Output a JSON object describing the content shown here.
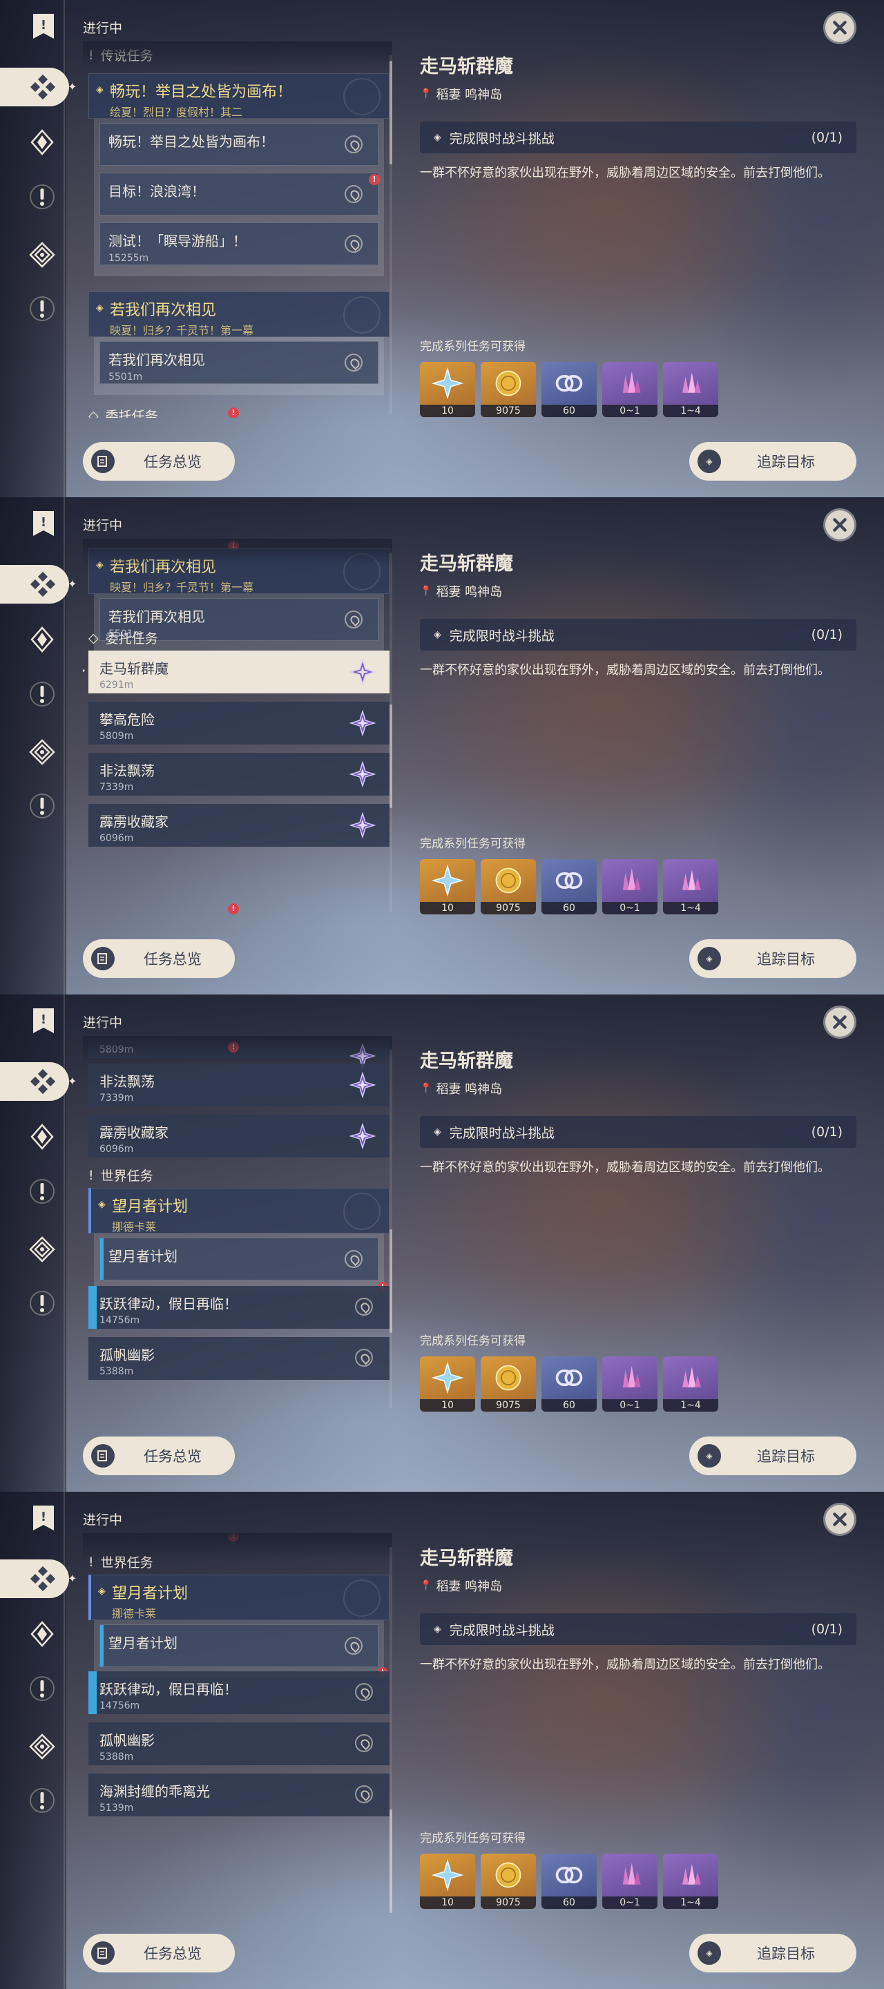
{
  "header": {
    "in_progress": "进行中"
  },
  "sections": {
    "legend": "传说任务",
    "commission": "委托任务",
    "world": "世界任务",
    "commission_cut": "委托任务",
    "world_cut": "世界任务"
  },
  "legend_quests": [
    {
      "title": "畅玩！举目之处皆为画布！",
      "subtitle": "绘夏！烈日？度假村！其二",
      "subs": [
        {
          "title": "畅玩！举目之处皆为画布！",
          "dist": ""
        },
        {
          "title": "目标！浪浪湾！",
          "dist": ""
        },
        {
          "title": "测试！「瞑导游船」！",
          "dist": "15255m"
        }
      ]
    },
    {
      "title": "若我们再次相见",
      "subtitle": "映夏！归乡？千灵节！第一幕",
      "subs": [
        {
          "title": "若我们再次相见",
          "dist": "5501m"
        }
      ]
    }
  ],
  "commissions": [
    {
      "title": "走马斩群魔",
      "dist": "6291m"
    },
    {
      "title": "攀高危险",
      "dist": "5809m"
    },
    {
      "title": "非法飘荡",
      "dist": "7339m"
    },
    {
      "title": "霹雳收藏家",
      "dist": "6096m"
    }
  ],
  "world_quests": {
    "parent_title": "望月者计划",
    "parent_sub": "挪德卡莱",
    "sub_title": "望月者计划",
    "items": [
      {
        "title": "跃跃律动，假日再临！",
        "dist": "14756m"
      },
      {
        "title": "孤帆幽影",
        "dist": "5388m"
      },
      {
        "title": "海渊封缠的乖离光",
        "dist": "5139m"
      }
    ]
  },
  "detail": {
    "title": "走马斩群魔",
    "location": "稻妻 鸣神岛",
    "objective": "完成限时战斗挑战",
    "objective_count": "(0/1)",
    "description": "一群不怀好意的家伙出现在野外，威胁着周边区域的安全。前去打倒他们。",
    "rewards_head": "完成系列任务可获得",
    "rewards": [
      {
        "icon": "adventure-exp-icon",
        "count": "10"
      },
      {
        "icon": "mora-icon",
        "count": "9075"
      },
      {
        "icon": "companionship-exp-icon",
        "count": "60"
      },
      {
        "icon": "crystal-ore-icon",
        "count": "0~1"
      },
      {
        "icon": "primogem-crystal-icon",
        "count": "1~4"
      }
    ]
  },
  "buttons": {
    "overview": "任务总览",
    "track": "追踪目标"
  },
  "colors": {
    "gold": "#f0d98c",
    "paper": "#ece5d8",
    "alert": "#d9454e",
    "world_blue": "#3fa6e0"
  }
}
